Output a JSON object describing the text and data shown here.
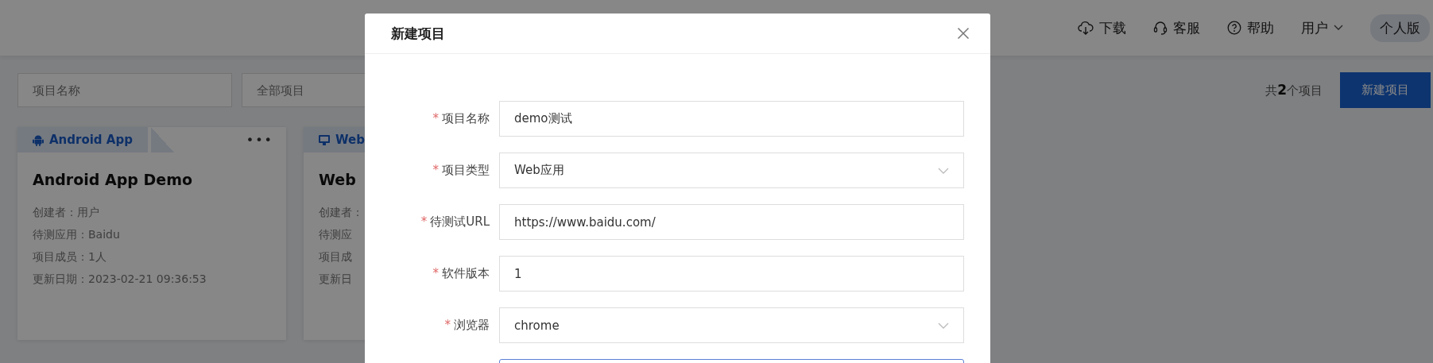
{
  "header": {
    "nav": [
      {
        "label": "下载"
      },
      {
        "label": "客服"
      },
      {
        "label": "帮助"
      }
    ],
    "user_menu": {
      "label": "用户"
    },
    "edition_badge": "个人版"
  },
  "toolbar": {
    "name_filter": {
      "placeholder": "项目名称"
    },
    "type_filter": {
      "placeholder": "全部项目"
    },
    "count": "共**2**个项目",
    "new_button": "新建项目"
  },
  "cards": [
    {
      "tag": "Android App",
      "title": "Android App Demo",
      "details": [
        "创建者：用户",
        "待测应用：Baidu",
        "项目成员：1人",
        "更新日期：2023-02-21 09:36:53"
      ],
      "menu": "•••"
    },
    {
      "tag": "Web",
      "title": "Web",
      "details": [
        "创建者：",
        "待测应",
        "项目成",
        "更新日"
      ]
    }
  ],
  "modal": {
    "title": "新建项目",
    "fields": [
      {
        "kind": "text",
        "required_mark": "*",
        "label": "项目名称",
        "value": "demo测试",
        "focused": false
      },
      {
        "kind": "select",
        "required_mark": "*",
        "label": "项目类型",
        "value": "Web应用",
        "focused": false
      },
      {
        "kind": "text",
        "required_mark": "*",
        "label": "待测试URL",
        "value": "https://www.baidu.com/",
        "focused": false
      },
      {
        "kind": "text",
        "required_mark": "*",
        "label": "软件版本",
        "value": "1",
        "focused": false
      },
      {
        "kind": "select",
        "required_mark": "*",
        "label": "浏览器",
        "value": "chrome",
        "focused": false
      },
      {
        "kind": "text",
        "focused": true
      }
    ]
  }
}
